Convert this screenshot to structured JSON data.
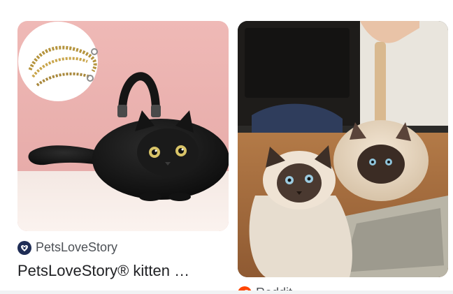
{
  "results": [
    {
      "source": "PetsLoveStory",
      "title": "PetsLoveStory® kitten …",
      "favicon": "petslovestory-heart-paw-icon",
      "image_subject": "black-cat-plush-handbag"
    },
    {
      "source": "Reddit",
      "title": "",
      "favicon": "reddit-alien-icon",
      "image_subject": "siamese-cat-with-cat-purse"
    }
  ],
  "colors": {
    "source_text": "#4d5156",
    "title_text": "#202124",
    "reddit_brand": "#ff4500",
    "petslove_brand": "#1f2d55"
  }
}
